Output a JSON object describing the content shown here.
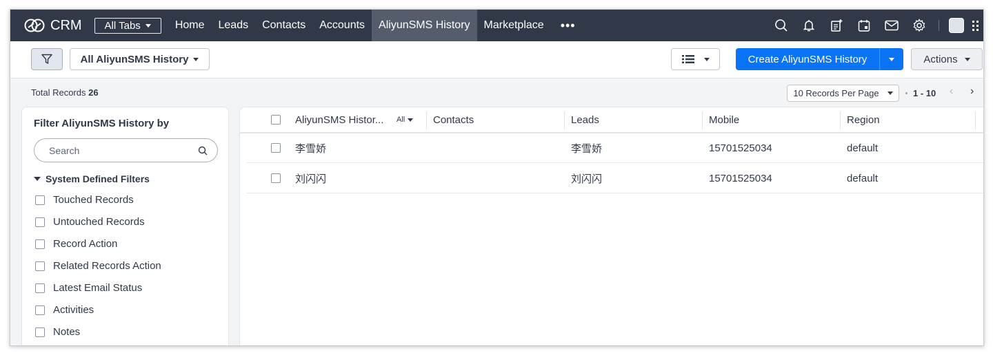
{
  "nav": {
    "brand": "CRM",
    "all_tabs_label": "All Tabs",
    "tabs": [
      {
        "label": "Home"
      },
      {
        "label": "Leads"
      },
      {
        "label": "Contacts"
      },
      {
        "label": "Accounts"
      },
      {
        "label": "AliyunSMS History",
        "active": true
      },
      {
        "label": "Marketplace"
      }
    ],
    "more_label": "•••",
    "icons": [
      "search-icon",
      "bell-icon",
      "add-note-icon",
      "calendar-icon",
      "mail-icon",
      "gear-icon",
      "avatar",
      "apps-grid-icon"
    ]
  },
  "toolbar": {
    "view_label": "All AliyunSMS History",
    "create_label": "Create AliyunSMS History",
    "actions_label": "Actions",
    "accent_color": "#0b73f5"
  },
  "records": {
    "total_label": "Total Records",
    "total_count": "26",
    "per_page_label": "10 Records Per Page",
    "range_label": "1 - 10"
  },
  "filter_panel": {
    "title": "Filter AliyunSMS History by",
    "search_placeholder": "Search",
    "section_title": "System Defined Filters",
    "items": [
      {
        "label": "Touched Records"
      },
      {
        "label": "Untouched Records"
      },
      {
        "label": "Record Action"
      },
      {
        "label": "Related Records Action"
      },
      {
        "label": "Latest Email Status"
      },
      {
        "label": "Activities"
      },
      {
        "label": "Notes"
      }
    ]
  },
  "table": {
    "columns": [
      {
        "label": "AliyunSMS Histor..."
      },
      {
        "label": "Contacts"
      },
      {
        "label": "Leads"
      },
      {
        "label": "Mobile"
      },
      {
        "label": "Region"
      }
    ],
    "name_filter_label": "All",
    "rows": [
      {
        "name": "李雪娇",
        "contacts": "",
        "leads": "李雪娇",
        "mobile": "15701525034",
        "region": "default"
      },
      {
        "name": "刘闪闪",
        "contacts": "",
        "leads": "刘闪闪",
        "mobile": "15701525034",
        "region": "default"
      }
    ]
  }
}
